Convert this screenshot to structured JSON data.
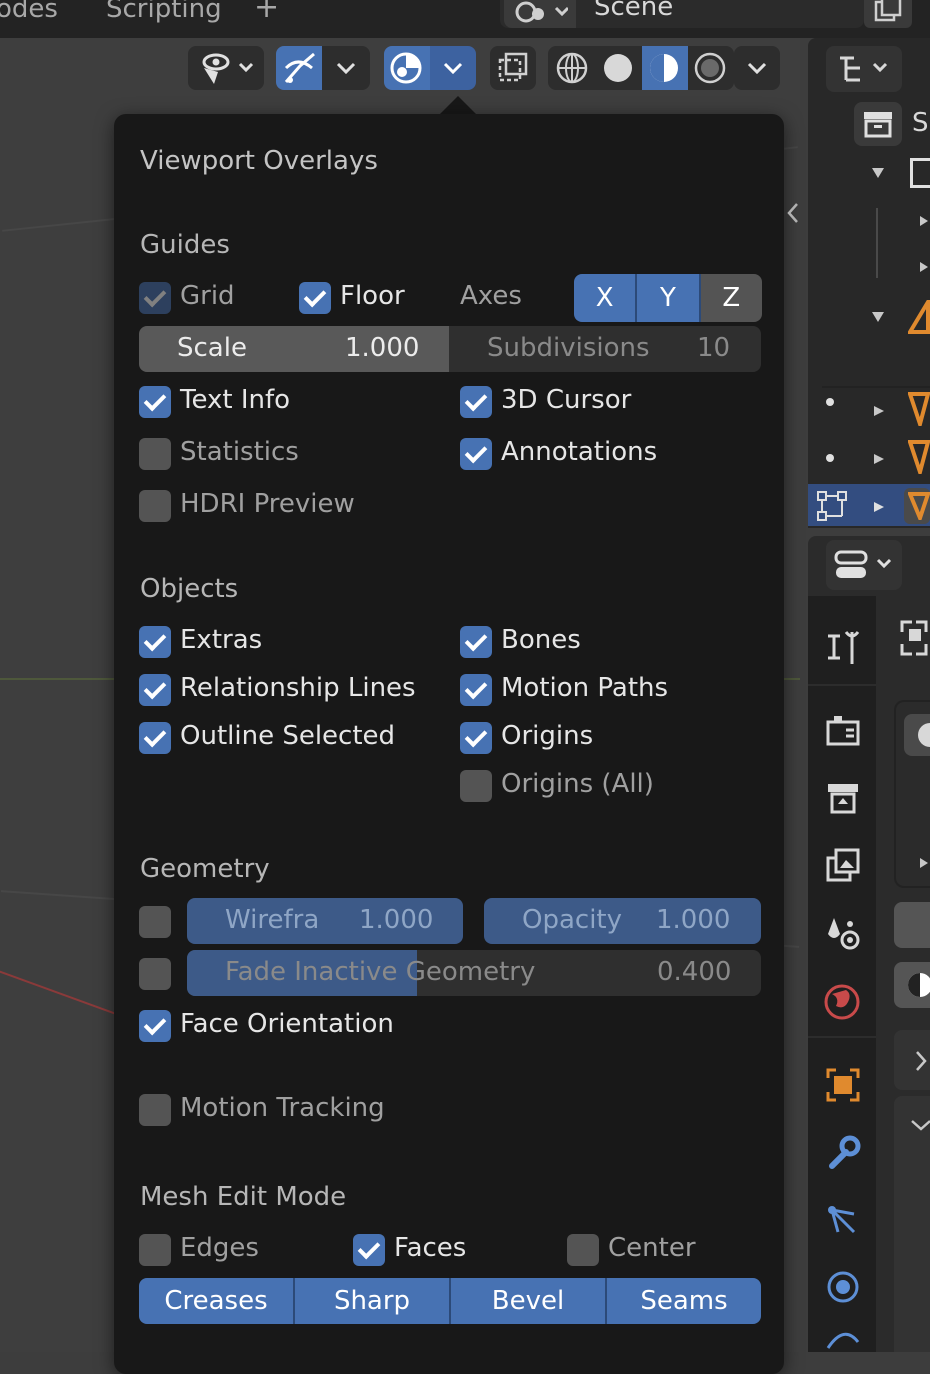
{
  "workspace_tabs": [
    "odes",
    "Scripting"
  ],
  "add_workspace": "+",
  "scene_name": "Scene",
  "outliner_partial_text": "S",
  "popover": {
    "title": "Viewport Overlays",
    "guides": {
      "heading": "Guides",
      "grid": {
        "label": "Grid",
        "checked": true
      },
      "floor": {
        "label": "Floor",
        "checked": true
      },
      "axes_label": "Axes",
      "axes": [
        {
          "label": "X",
          "on": true
        },
        {
          "label": "Y",
          "on": true
        },
        {
          "label": "Z",
          "on": false
        }
      ],
      "scale_label": "Scale",
      "scale_value": "1.000",
      "subdivisions_label": "Subdivisions",
      "subdivisions_value": "10",
      "text_info": {
        "label": "Text Info",
        "checked": true
      },
      "cursor_3d": {
        "label": "3D Cursor",
        "checked": true
      },
      "statistics": {
        "label": "Statistics",
        "checked": false
      },
      "annotations": {
        "label": "Annotations",
        "checked": true
      },
      "hdri_preview": {
        "label": "HDRI Preview",
        "checked": false
      }
    },
    "objects": {
      "heading": "Objects",
      "extras": {
        "label": "Extras",
        "checked": true
      },
      "bones": {
        "label": "Bones",
        "checked": true
      },
      "relationship_lines": {
        "label": "Relationship Lines",
        "checked": true
      },
      "motion_paths": {
        "label": "Motion Paths",
        "checked": true
      },
      "outline_selected": {
        "label": "Outline Selected",
        "checked": true
      },
      "origins": {
        "label": "Origins",
        "checked": true
      },
      "origins_all": {
        "label": "Origins (All)",
        "checked": false
      }
    },
    "geometry": {
      "heading": "Geometry",
      "wireframe_label": "Wirefra",
      "wireframe_value": "1.000",
      "opacity_label": "Opacity",
      "opacity_value": "1.000",
      "fade_label": "Fade Inactive Geometry",
      "fade_value": "0.400",
      "fade_fraction": 0.4,
      "face_orientation": {
        "label": "Face Orientation",
        "checked": true
      }
    },
    "motion_tracking": {
      "label": "Motion Tracking",
      "checked": false
    },
    "mesh_edit": {
      "heading": "Mesh Edit Mode",
      "edges": {
        "label": "Edges",
        "checked": false
      },
      "faces": {
        "label": "Faces",
        "checked": true
      },
      "center": {
        "label": "Center",
        "checked": false
      },
      "buttons": [
        "Creases",
        "Sharp",
        "Bevel",
        "Seams"
      ]
    }
  },
  "colors": {
    "accent": "#4772b3",
    "panel": "#181818",
    "orange": "#e08a2e"
  }
}
